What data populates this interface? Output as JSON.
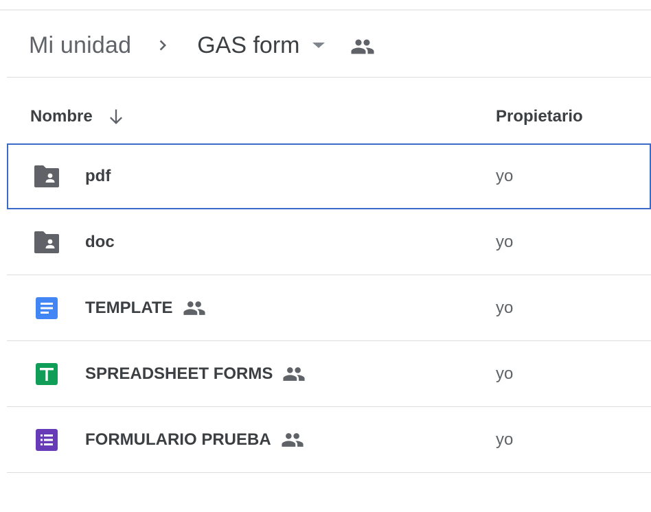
{
  "breadcrumb": {
    "root": "Mi unidad",
    "current": "GAS form"
  },
  "columns": {
    "name": "Nombre",
    "owner": "Propietario"
  },
  "files": [
    {
      "name": "pdf",
      "type": "shared-folder",
      "owner": "yo",
      "shared": false,
      "selected": true
    },
    {
      "name": "doc",
      "type": "shared-folder",
      "owner": "yo",
      "shared": false,
      "selected": false
    },
    {
      "name": "TEMPLATE",
      "type": "google-docs",
      "owner": "yo",
      "shared": true,
      "selected": false
    },
    {
      "name": "SPREADSHEET FORMS",
      "type": "google-sheets",
      "owner": "yo",
      "shared": true,
      "selected": false
    },
    {
      "name": "FORMULARIO PRUEBA",
      "type": "google-forms",
      "owner": "yo",
      "shared": true,
      "selected": false
    }
  ],
  "colors": {
    "folder": "#5f6368",
    "docs": "#4285f4",
    "sheets": "#0f9d58",
    "forms": "#673ab7",
    "selection": "#3b6bc9"
  }
}
